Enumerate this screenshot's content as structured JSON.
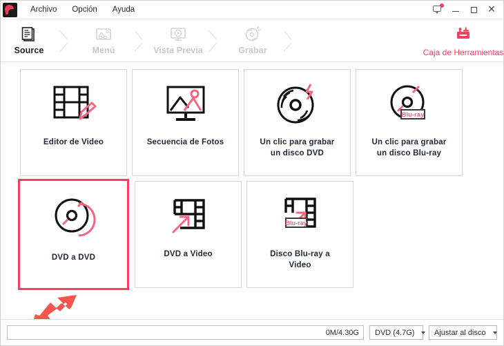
{
  "window": {
    "logo_icon": "app-logo-icon",
    "menus": [
      {
        "label": "Archivo"
      },
      {
        "label": "Opción"
      },
      {
        "label": "Ayuda"
      }
    ],
    "controls": {
      "feedback_icon": "feedback-bubble-icon",
      "minimize_icon": "minimize-icon",
      "maximize_icon": "maximize-icon",
      "close_icon": "close-icon",
      "close_glyph": "✕"
    }
  },
  "steps": [
    {
      "label": "Source",
      "icon": "documents-stack-icon",
      "state": "active"
    },
    {
      "label": "Menú",
      "icon": "picture-frame-icon",
      "state": "disabled"
    },
    {
      "label": "Vista Previa",
      "icon": "monitor-play-icon",
      "state": "disabled"
    },
    {
      "label": "Grabar",
      "icon": "burn-disc-icon",
      "state": "disabled"
    }
  ],
  "toolbox": {
    "label": "Caja de Herramientas",
    "icon": "toolbox-icon",
    "color": "#f4405f"
  },
  "cards": [
    {
      "label": "Editor de Video",
      "icon": "film-strip-pencil-icon",
      "selected": false
    },
    {
      "label": "Secuencia de Fotos",
      "icon": "monitor-photo-icon",
      "selected": false
    },
    {
      "label": "Un clic para grabar\nun disco DVD",
      "icon": "disc-lightning-icon",
      "selected": false
    },
    {
      "label": "Un clic para grabar\nun disco Blu-ray",
      "icon": "disc-bluray-icon",
      "selected": false
    },
    {
      "label": "DVD a DVD",
      "icon": "disc-to-disc-icon",
      "selected": true
    },
    {
      "label": "DVD a Video",
      "icon": "film-arrow-icon",
      "selected": false
    },
    {
      "label": "Disco Blu-ray a\nVideo",
      "icon": "film-bluray-arrow-icon",
      "selected": false
    }
  ],
  "annotation": {
    "arrow_icon": "red-pointer-arrow",
    "color": "#f4564f"
  },
  "statusbar": {
    "progress_text": "0M/4.30G",
    "disc_select": {
      "value": "DVD (4.7G)",
      "caret_icon": "chevron-down-icon"
    },
    "fit_select": {
      "value": "Ajustar al disco",
      "caret_icon": "chevron-down-icon"
    }
  },
  "labels": {
    "bluray_badge": "Blu-ray"
  }
}
